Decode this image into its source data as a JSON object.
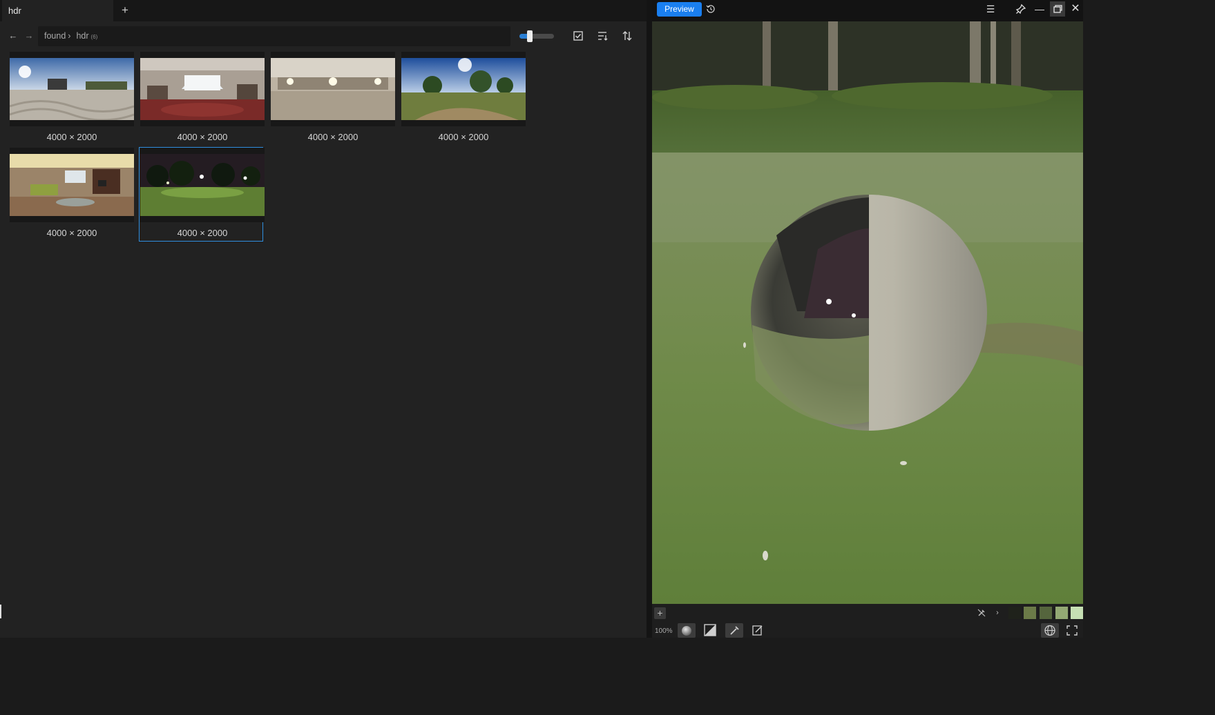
{
  "tabs": [
    {
      "label": "hdr"
    }
  ],
  "toolbar": {
    "breadcrumb": {
      "root": "found",
      "separator": "›",
      "current": "hdr",
      "count": "(6)"
    },
    "size_slider": {
      "value": 0.25
    }
  },
  "thumbnails": [
    {
      "label": "4000 × 2000",
      "scene": "outdoor-plaza",
      "selected": false
    },
    {
      "label": "4000 × 2000",
      "scene": "living-room-red-rug",
      "selected": false
    },
    {
      "label": "4000 × 2000",
      "scene": "bright-hall",
      "selected": false
    },
    {
      "label": "4000 × 2000",
      "scene": "park-trees",
      "selected": false
    },
    {
      "label": "4000 × 2000",
      "scene": "living-room-green-sofa",
      "selected": false
    },
    {
      "label": "4000 × 2000",
      "scene": "night-park",
      "selected": true
    }
  ],
  "preview": {
    "button_label": "Preview",
    "zoom": "100%",
    "swatch_colors": [
      "#1f221b",
      "#6b7a48",
      "#55653d",
      "#93a874",
      "#c6e0b4"
    ]
  },
  "colors": {
    "accent": "#1a7ff0",
    "selection": "#2f8fe0"
  }
}
